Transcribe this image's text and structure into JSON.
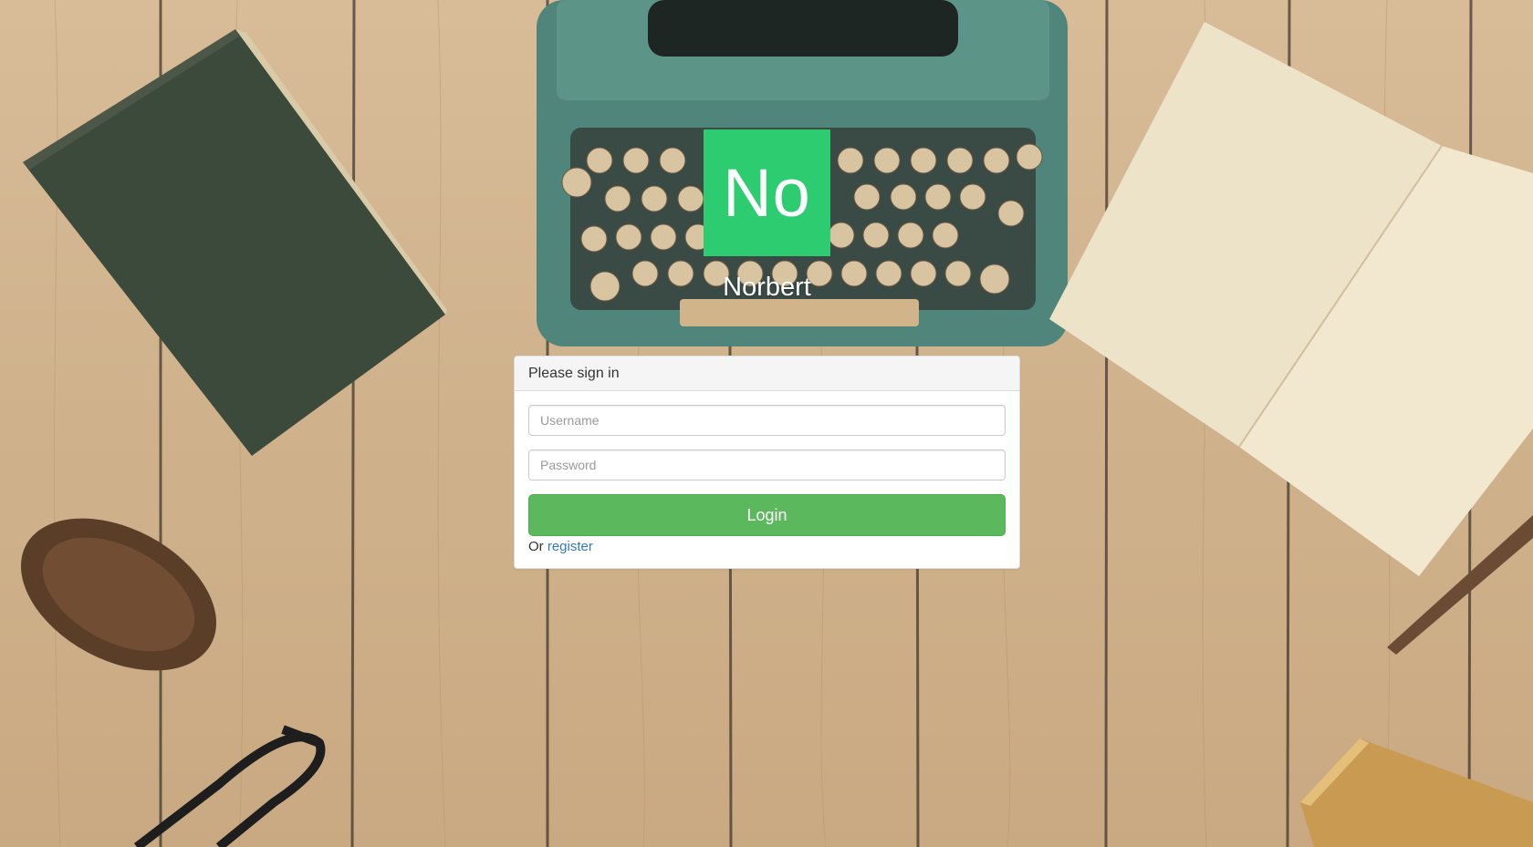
{
  "brand": {
    "logo_text": "No",
    "app_name": "Norbert",
    "accent_color": "#2ecc71"
  },
  "login_panel": {
    "heading": "Please sign in",
    "username_placeholder": "Username",
    "password_placeholder": "Password",
    "login_label": "Login",
    "register_prefix": "Or",
    "register_link": "register",
    "button_color": "#5cb85c",
    "link_color": "#337ab7"
  },
  "background": {
    "icons": [
      "book-icon",
      "typewriter-icon",
      "notebook-icon",
      "pinecone-icon",
      "glasses-icon",
      "pencil-icon",
      "pencil-box-icon"
    ]
  }
}
